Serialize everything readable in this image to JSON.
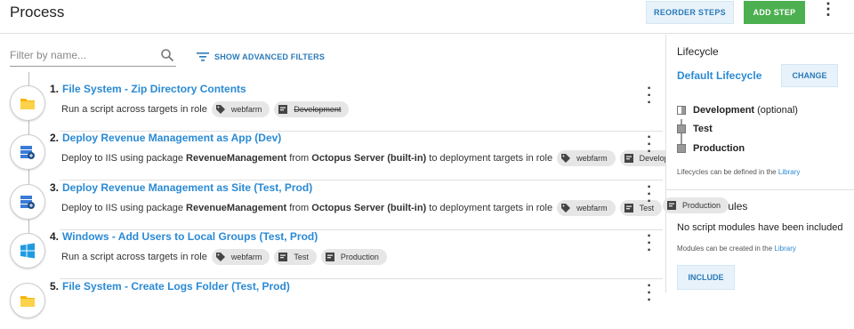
{
  "header": {
    "title": "Process",
    "reorder_label": "REORDER STEPS",
    "add_label": "ADD STEP"
  },
  "filter": {
    "placeholder": "Filter by name...",
    "value": "",
    "advanced_label": "SHOW ADVANCED FILTERS"
  },
  "steps": [
    {
      "number": "1.",
      "name": "File System - Zip Directory Contents",
      "desc_pre": "Run a script across targets in role",
      "icon": "folder-icon",
      "chips": [
        {
          "label": "webfarm",
          "kind": "tag-icon",
          "strike": false
        },
        {
          "label": "Development",
          "kind": "env-icon",
          "strike": true
        }
      ]
    },
    {
      "number": "2.",
      "name": "Deploy Revenue Management as App (Dev)",
      "desc_pre": "Deploy to IIS using package",
      "desc_pkg": "RevenueManagement",
      "desc_mid": "from",
      "desc_feed": "Octopus Server (built-in)",
      "desc_post": "to deployment targets in role",
      "icon": "server-icon",
      "chips": [
        {
          "label": "webfarm",
          "kind": "tag-icon",
          "strike": false
        },
        {
          "label": "Development",
          "kind": "env-icon",
          "strike": false
        }
      ]
    },
    {
      "number": "3.",
      "name": "Deploy Revenue Management as Site (Test, Prod)",
      "desc_pre": "Deploy to IIS using package",
      "desc_pkg": "RevenueManagement",
      "desc_mid": "from",
      "desc_feed": "Octopus Server (built-in)",
      "desc_post": "to deployment targets in role",
      "icon": "server-icon",
      "chips": [
        {
          "label": "webfarm",
          "kind": "tag-icon",
          "strike": false
        },
        {
          "label": "Test",
          "kind": "env-icon",
          "strike": false
        },
        {
          "label": "Production",
          "kind": "env-icon",
          "strike": false
        }
      ]
    },
    {
      "number": "4.",
      "name": "Windows - Add Users to Local Groups (Test, Prod)",
      "desc_pre": "Run a script across targets in role",
      "icon": "windows-icon",
      "chips": [
        {
          "label": "webfarm",
          "kind": "tag-icon",
          "strike": false
        },
        {
          "label": "Test",
          "kind": "env-icon",
          "strike": false
        },
        {
          "label": "Production",
          "kind": "env-icon",
          "strike": false
        }
      ]
    },
    {
      "number": "5.",
      "name": "File System - Create Logs Folder (Test, Prod)",
      "icon": "folder-icon"
    }
  ],
  "sidebar": {
    "lifecycle_heading": "Lifecycle",
    "lifecycle_name": "Default Lifecycle",
    "change_label": "CHANGE",
    "phases": [
      {
        "name": "Development",
        "suffix": "(optional)"
      },
      {
        "name": "Test",
        "suffix": ""
      },
      {
        "name": "Production",
        "suffix": ""
      }
    ],
    "lifecycle_note": "Lifecycles can be defined in the",
    "lifecycle_link": "Library",
    "modules_heading": "Script Modules",
    "modules_empty": "No script modules have been included",
    "modules_note": "Modules can be created in the",
    "modules_link": "Library",
    "include_label": "INCLUDE"
  },
  "colors": {
    "accent": "#2a8ad4",
    "add_button": "#4caf50",
    "chip_bg": "#e6e6e6"
  }
}
